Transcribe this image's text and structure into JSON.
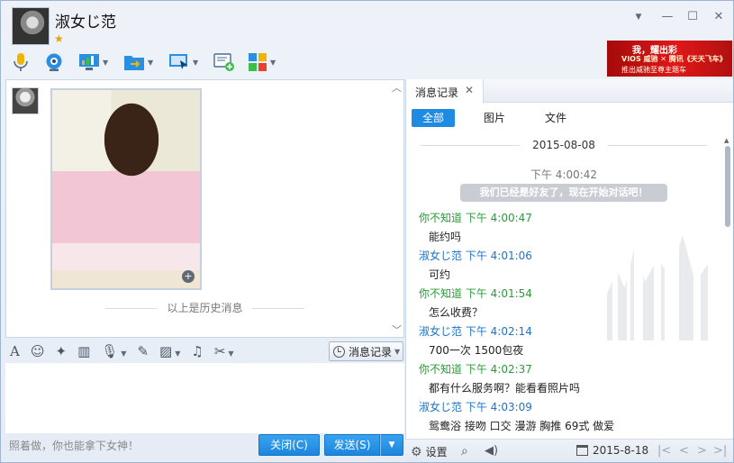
{
  "window": {
    "contact_name": "淑女じ范",
    "star": "★",
    "controls": {
      "dropdown": "▼",
      "minimize": "—",
      "maximize": "☐",
      "close": "✕"
    }
  },
  "toolbar": {
    "items": [
      {
        "icon": "microphone-icon"
      },
      {
        "icon": "video-camera-icon"
      },
      {
        "icon": "screen-share-icon"
      },
      {
        "icon": "file-transfer-icon"
      },
      {
        "icon": "remote-assist-icon"
      },
      {
        "icon": "add-note-icon"
      },
      {
        "icon": "apps-grid-icon"
      }
    ]
  },
  "ad": {
    "line1": "我，耀出彩",
    "line2": "VIOS 威驰 ✕ 腾讯《天天飞车》",
    "line3": "推出威驰至尊主题车"
  },
  "chat": {
    "history_label": "以上是历史消息",
    "collapse": "︿",
    "expand": "﹀"
  },
  "input_toolbar": {
    "history_button": "消息记录",
    "placeholder": "照着做，你也能拿下女神！",
    "close_button": "关闭(C)",
    "send_button": "发送(S)"
  },
  "history_panel": {
    "tab_label": "消息记录",
    "tab_close": "✕",
    "filters": [
      "全部",
      "图片",
      "文件"
    ],
    "date": "2015-08-08",
    "system_time": "下午 4:00:42",
    "system_message": "我们已经是好友了，现在开始对话吧！",
    "messages": [
      {
        "sender": "你不知道",
        "time": "下午 4:00:47",
        "text": "能约吗",
        "mine": false
      },
      {
        "sender": "淑女じ范",
        "time": "下午 4:01:06",
        "text": "可约",
        "mine": true
      },
      {
        "sender": "你不知道",
        "time": "下午 4:01:54",
        "text": "怎么收费？",
        "mine": false
      },
      {
        "sender": "淑女じ范",
        "time": "下午 4:02:14",
        "text": "700一次 1500包夜",
        "mine": true
      },
      {
        "sender": "你不知道",
        "time": "下午 4:02:37",
        "text": "都有什么服务啊？能看看照片吗",
        "mine": false
      },
      {
        "sender": "淑女じ范",
        "time": "下午 4:03:09",
        "text": "鸳鸯浴 接吻 口交 漫游 胸推 69式 做爱",
        "mine": true
      }
    ]
  },
  "bottom_bar": {
    "settings_label": "设置",
    "date": "2015-8-18",
    "nav": [
      "|<",
      "<",
      ">",
      ">|"
    ]
  },
  "colors": {
    "accent": "#1f8ae2",
    "other_sender": "#2b9b3a",
    "self_sender": "#1f73c5"
  }
}
